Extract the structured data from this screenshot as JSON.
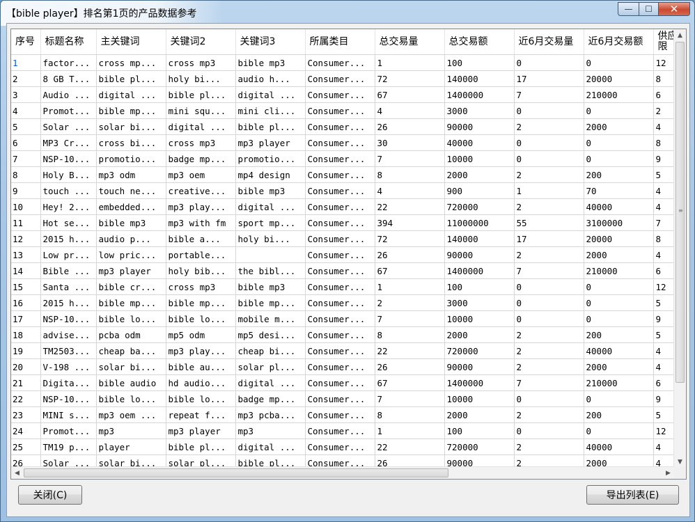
{
  "window": {
    "title": "【bible player】排名第1页的产品数据参考"
  },
  "title_buttons": {
    "minimize": "—",
    "maximize": "☐",
    "close": "✕"
  },
  "table": {
    "columns": [
      "序号",
      "标题名称",
      "主关键词",
      "关键词2",
      "关键词3",
      "所属类目",
      "总交易量",
      "总交易额",
      "近6月交易量",
      "近6月交易额",
      "供应限"
    ],
    "rows": [
      [
        "1",
        "factor...",
        "cross mp...",
        "cross mp3",
        "bible mp3",
        "Consumer...",
        "1",
        "100",
        "0",
        "0",
        "12"
      ],
      [
        "2",
        "8 GB T...",
        "bible pl...",
        "holy  bi...",
        "audio  h...",
        "Consumer...",
        "72",
        "140000",
        "17",
        "20000",
        "8"
      ],
      [
        "3",
        "Audio ...",
        "digital ...",
        "bible pl...",
        "digital ...",
        "Consumer...",
        "67",
        "1400000",
        "7",
        "210000",
        "6"
      ],
      [
        "4",
        "Promot...",
        "bible mp...",
        "mini squ...",
        "mini cli...",
        "Consumer...",
        "4",
        "3000",
        "0",
        "0",
        "2"
      ],
      [
        "5",
        "Solar ...",
        "solar bi...",
        "digital ...",
        "bible pl...",
        "Consumer...",
        "26",
        "90000",
        "2",
        "2000",
        "4"
      ],
      [
        "6",
        "MP3 Cr...",
        "cross bi...",
        "cross mp3",
        "mp3 player",
        "Consumer...",
        "30",
        "40000",
        "0",
        "0",
        "8"
      ],
      [
        "7",
        "NSP-10...",
        "promotio...",
        "badge mp...",
        "promotio...",
        "Consumer...",
        "7",
        "10000",
        "0",
        "0",
        "9"
      ],
      [
        "8",
        "Holy B...",
        "mp3 odm",
        "mp3 oem",
        "mp4 design",
        "Consumer...",
        "8",
        "2000",
        "2",
        "200",
        "5"
      ],
      [
        "9",
        "touch ...",
        "touch ne...",
        "creative...",
        "bible mp3",
        "Consumer...",
        "4",
        "900",
        "1",
        "70",
        "4"
      ],
      [
        "10",
        "Hey! 2...",
        "embedded...",
        "mp3 play...",
        "digital ...",
        "Consumer...",
        "22",
        "720000",
        "2",
        "40000",
        "4"
      ],
      [
        "11",
        "Hot se...",
        "bible mp3",
        "mp3 with fm",
        "sport mp...",
        "Consumer...",
        "394",
        "11000000",
        "55",
        "3100000",
        "7"
      ],
      [
        "12",
        "2015 h...",
        "audio  p...",
        "bible  a...",
        "holy  bi...",
        "Consumer...",
        "72",
        "140000",
        "17",
        "20000",
        "8"
      ],
      [
        "13",
        "Low pr...",
        "low pric...",
        "portable...",
        "",
        "Consumer...",
        "26",
        "90000",
        "2",
        "2000",
        "4"
      ],
      [
        "14",
        "Bible ...",
        "mp3 player",
        "holy bib...",
        "the bibl...",
        "Consumer...",
        "67",
        "1400000",
        "7",
        "210000",
        "6"
      ],
      [
        "15",
        "Santa ...",
        "bible cr...",
        "cross mp3",
        "bible mp3",
        "Consumer...",
        "1",
        "100",
        "0",
        "0",
        "12"
      ],
      [
        "16",
        "2015 h...",
        "bible mp...",
        "bible mp...",
        "bible mp...",
        "Consumer...",
        "2",
        "3000",
        "0",
        "0",
        "5"
      ],
      [
        "17",
        "NSP-10...",
        "bible lo...",
        "bible lo...",
        "mobile m...",
        "Consumer...",
        "7",
        "10000",
        "0",
        "0",
        "9"
      ],
      [
        "18",
        "advise...",
        "pcba odm",
        "mp5 odm",
        "mp5 desi...",
        "Consumer...",
        "8",
        "2000",
        "2",
        "200",
        "5"
      ],
      [
        "19",
        "TM2503...",
        "cheap ba...",
        "mp3 play...",
        "cheap bi...",
        "Consumer...",
        "22",
        "720000",
        "2",
        "40000",
        "4"
      ],
      [
        "20",
        "V-198 ...",
        "solar bi...",
        "bible au...",
        "solar pl...",
        "Consumer...",
        "26",
        "90000",
        "2",
        "2000",
        "4"
      ],
      [
        "21",
        "Digita...",
        "bible audio",
        "hd audio...",
        "digital ...",
        "Consumer...",
        "67",
        "1400000",
        "7",
        "210000",
        "6"
      ],
      [
        "22",
        "NSP-10...",
        "bible lo...",
        "bible lo...",
        "badge mp...",
        "Consumer...",
        "7",
        "10000",
        "0",
        "0",
        "9"
      ],
      [
        "23",
        "MINI s...",
        "mp3 oem ...",
        "repeat f...",
        "mp3 pcba...",
        "Consumer...",
        "8",
        "2000",
        "2",
        "200",
        "5"
      ],
      [
        "24",
        "Promot...",
        "mp3",
        "mp3 player",
        "mp3",
        "Consumer...",
        "1",
        "100",
        "0",
        "0",
        "12"
      ],
      [
        "25",
        "TM19 p...",
        "player",
        "bible pl...",
        "digital ...",
        "Consumer...",
        "22",
        "720000",
        "2",
        "40000",
        "4"
      ],
      [
        "26",
        "Solar ...",
        "solar bi...",
        "solar pl...",
        "bible pl...",
        "Consumer...",
        "26",
        "90000",
        "2",
        "2000",
        "4"
      ]
    ]
  },
  "buttons": {
    "close": "关闭(C)",
    "export": "导出列表(E)"
  },
  "colors": {
    "selected_cell_text": "#0a58ca",
    "title_bar": "#a9c7e6"
  }
}
